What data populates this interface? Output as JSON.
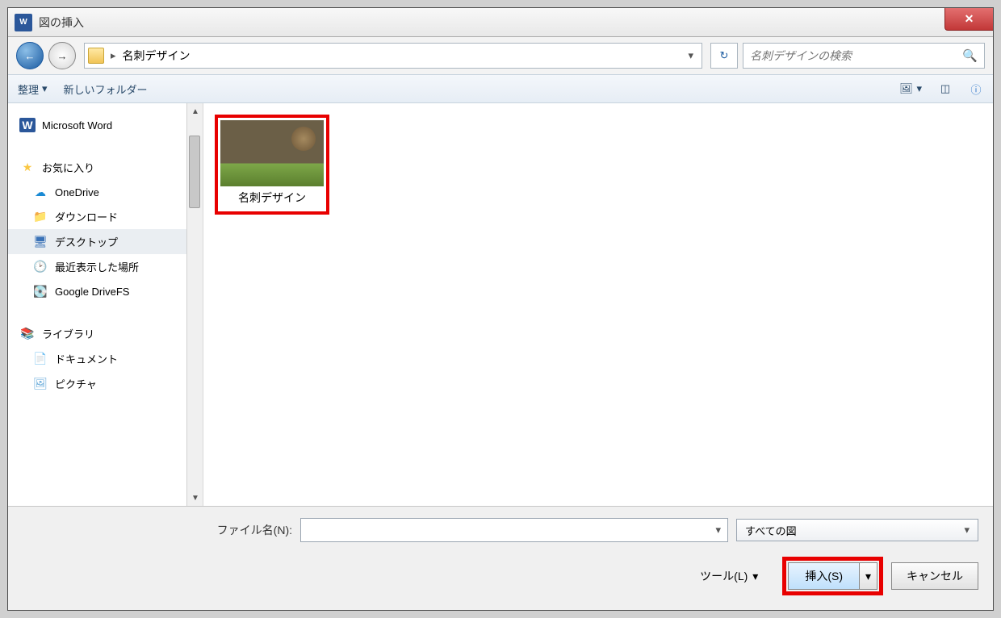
{
  "title": "図の挿入",
  "breadcrumb": {
    "folder": "名刺デザイン"
  },
  "search": {
    "placeholder": "名刺デザインの検索"
  },
  "toolbar": {
    "organize": "整理",
    "new_folder": "新しいフォルダー"
  },
  "sidebar": {
    "word": "Microsoft Word",
    "favorites": "お気に入り",
    "items": [
      {
        "icon": "onedrive",
        "label": "OneDrive"
      },
      {
        "icon": "download",
        "label": "ダウンロード"
      },
      {
        "icon": "desktop",
        "label": "デスクトップ"
      },
      {
        "icon": "recent",
        "label": "最近表示した場所"
      },
      {
        "icon": "gdrive",
        "label": "Google DriveFS"
      }
    ],
    "library": "ライブラリ",
    "lib_items": [
      {
        "icon": "doc",
        "label": "ドキュメント"
      },
      {
        "icon": "pic",
        "label": "ピクチャ"
      }
    ]
  },
  "files": [
    {
      "name": "名刺デザイン"
    }
  ],
  "footer": {
    "filename_label": "ファイル名(N):",
    "filetype": "すべての図",
    "tools": "ツール(L)",
    "insert": "挿入(S)",
    "cancel": "キャンセル"
  }
}
